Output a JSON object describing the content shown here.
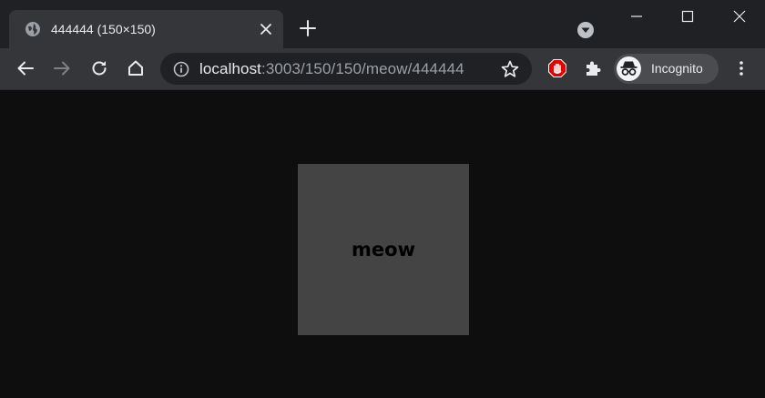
{
  "tab": {
    "title": "444444 (150×150)"
  },
  "address_bar": {
    "host": "localhost",
    "path": ":3003/150/150/meow/444444"
  },
  "profile": {
    "label": "Incognito"
  },
  "page": {
    "placeholder_text": "meow",
    "placeholder_color": "#444444",
    "background_color": "#0e0e0e"
  },
  "icons": {
    "tab_favicon": "globe-icon",
    "tab_close": "close-icon",
    "new_tab": "plus-icon",
    "tab_search": "chevron-down-icon",
    "minimize": "minimize-icon",
    "maximize": "maximize-icon",
    "close_window": "close-icon",
    "back": "back-arrow-icon",
    "forward": "forward-arrow-icon",
    "reload": "reload-icon",
    "home": "home-icon",
    "site_info": "info-icon",
    "bookmark": "star-icon",
    "adblock": "stop-hand-icon",
    "extensions": "puzzle-icon",
    "incognito": "incognito-icon",
    "menu": "kebab-menu-icon"
  }
}
